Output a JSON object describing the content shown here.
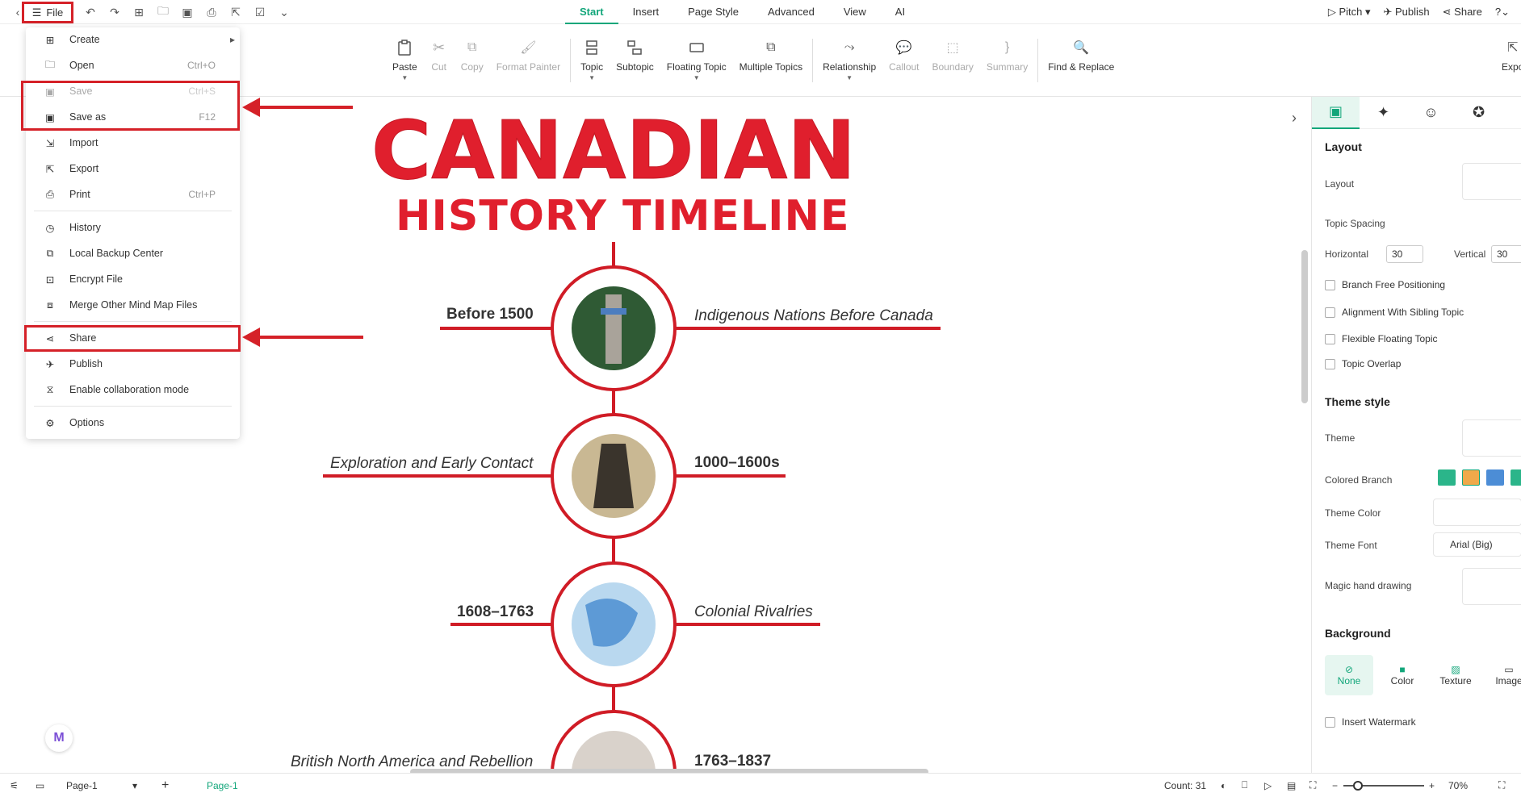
{
  "file_label": "File",
  "tabs": [
    "Start",
    "Insert",
    "Page Style",
    "Advanced",
    "View",
    "AI"
  ],
  "right_actions": {
    "pitch": "Pitch",
    "publish": "Publish",
    "share": "Share"
  },
  "ribbon": {
    "paste": "Paste",
    "cut": "Cut",
    "copy": "Copy",
    "format_painter": "Format Painter",
    "topic": "Topic",
    "subtopic": "Subtopic",
    "floating_topic": "Floating Topic",
    "multiple_topics": "Multiple Topics",
    "relationship": "Relationship",
    "callout": "Callout",
    "boundary": "Boundary",
    "summary": "Summary",
    "find_replace": "Find & Replace",
    "export": "Expo"
  },
  "menu": {
    "create": "Create",
    "open": "Open",
    "open_sc": "Ctrl+O",
    "save": "Save",
    "save_sc": "Ctrl+S",
    "save_as": "Save as",
    "save_as_sc": "F12",
    "import": "Import",
    "export": "Export",
    "print": "Print",
    "print_sc": "Ctrl+P",
    "history": "History",
    "backup": "Local Backup Center",
    "encrypt": "Encrypt File",
    "merge": "Merge Other Mind Map Files",
    "share": "Share",
    "publish": "Publish",
    "collab": "Enable collaboration mode",
    "options": "Options"
  },
  "timeline": {
    "title1": "CANADIAN",
    "title2": "HISTORY TIMELINE",
    "items": [
      {
        "left": "Before 1500",
        "right": "Indigenous Nations Before Canada"
      },
      {
        "left": "Exploration and Early Contact",
        "right": "1000–1600s"
      },
      {
        "left": "1608–1763",
        "right": "Colonial Rivalries"
      },
      {
        "left": "British North America and Rebellion",
        "right": "1763–1837"
      }
    ]
  },
  "panel": {
    "layout_h": "Layout",
    "layout": "Layout",
    "topic_spacing": "Topic Spacing",
    "horizontal": "Horizontal",
    "horizontal_val": "30",
    "vertical": "Vertical",
    "vertical_val": "30",
    "branch_free": "Branch Free Positioning",
    "align_sibling": "Alignment With Sibling Topic",
    "flexible_floating": "Flexible Floating Topic",
    "topic_overlap": "Topic Overlap",
    "theme_style_h": "Theme style",
    "theme": "Theme",
    "colored_branch": "Colored Branch",
    "theme_color": "Theme Color",
    "theme_font": "Theme Font",
    "theme_font_val": "Arial (Big)",
    "magic": "Magic hand drawing",
    "background_h": "Background",
    "bg_none": "None",
    "bg_color": "Color",
    "bg_texture": "Texture",
    "bg_image": "Image",
    "watermark": "Insert Watermark"
  },
  "status": {
    "page_sel": "Page-1",
    "page_tab": "Page-1",
    "count": "Count: 31",
    "zoom": "70%"
  },
  "colors": {
    "accent": "#12a67a",
    "highlight": "#d52128",
    "timeline_red": "#e01f2d"
  }
}
